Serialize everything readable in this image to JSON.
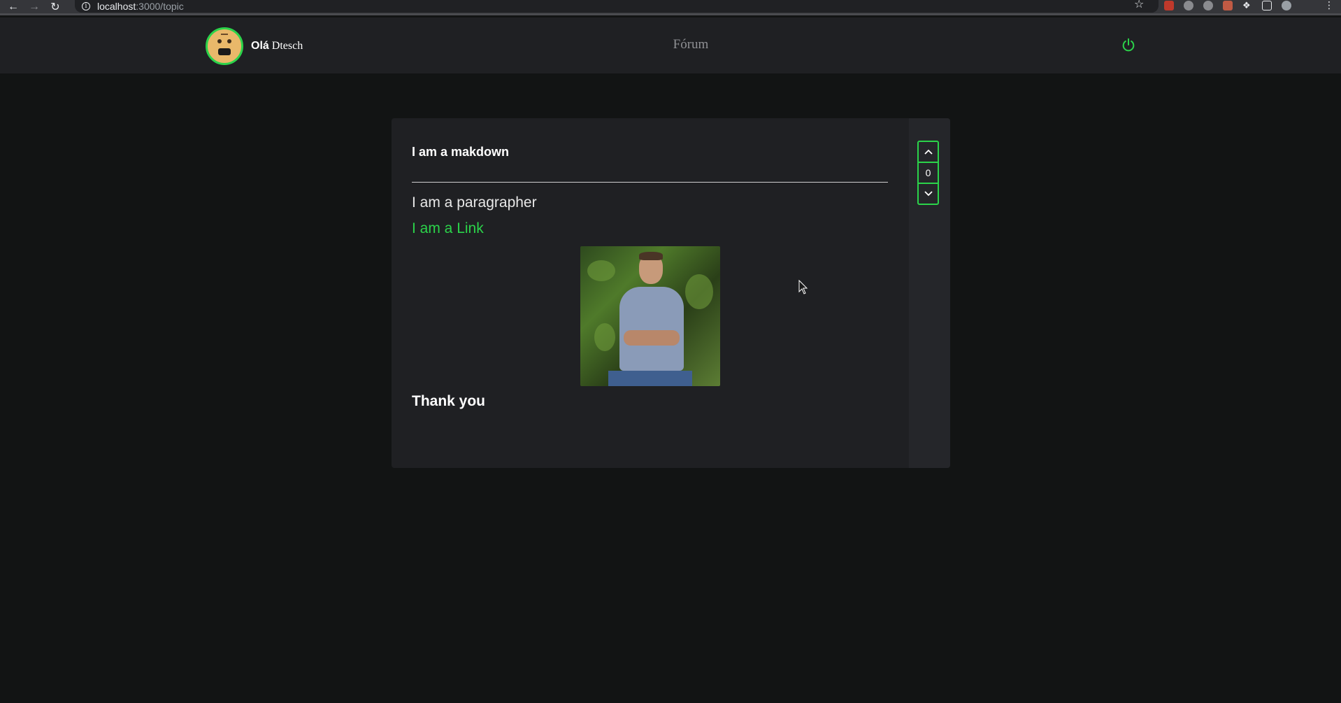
{
  "browser": {
    "url_host": "localhost",
    "url_path": ":3000/topic"
  },
  "header": {
    "greeting": "Olá",
    "username": "Dtesch",
    "title": "Fórum"
  },
  "topic": {
    "heading": "I am a makdown",
    "paragraph": "I am a paragrapher",
    "link_text": "I am a Link",
    "image_alt": "person-photo",
    "closing": "Thank you"
  },
  "votes": {
    "count": "0"
  },
  "colors": {
    "accent": "#2bd34a",
    "background": "#121414",
    "surface": "#1f2023"
  }
}
